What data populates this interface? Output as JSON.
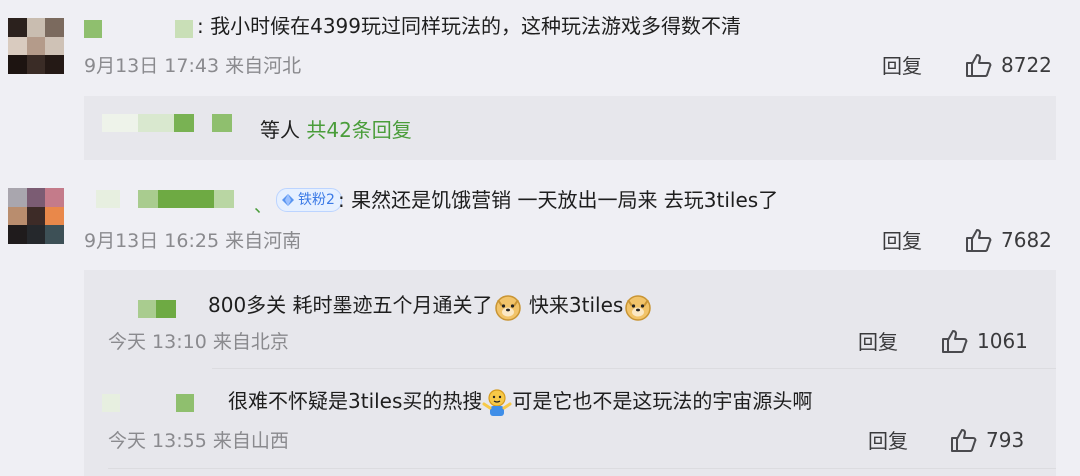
{
  "comments": [
    {
      "text": ": 我小时候在4399玩过同样玩法的，这种玩法游戏多得数不清",
      "meta": "9月13日 17:43 来自河北",
      "reply_label": "回复",
      "likes": "8722",
      "thread_summary": {
        "prefix": "等人",
        "link": "共42条回复"
      }
    },
    {
      "separator": "、",
      "badge": "铁粉2",
      "text": ": 果然还是饥饿营销 一天放出一局来 去玩3tiles了",
      "meta": "9月13日 16:25 来自河南",
      "reply_label": "回复",
      "likes": "7682",
      "replies": [
        {
          "text_a": "800多关 耗时墨迹五个月通关了",
          "text_b": " 快来3tiles",
          "meta": "今天 13:10 来自北京",
          "reply_label": "回复",
          "likes": "1061",
          "emoji": "doge-icon"
        },
        {
          "text_a": "很难不怀疑是3tiles买的热搜",
          "text_b": "可是它也不是这玩法的宇宙源头啊",
          "meta": "今天 13:55 来自山西",
          "reply_label": "回复",
          "likes": "793",
          "emoji": "shrug-icon"
        }
      ]
    }
  ],
  "colors": {
    "accent_green": "#4a9d3a",
    "badge_blue": "#3b7ae6",
    "panel": "#e7e7ec"
  }
}
